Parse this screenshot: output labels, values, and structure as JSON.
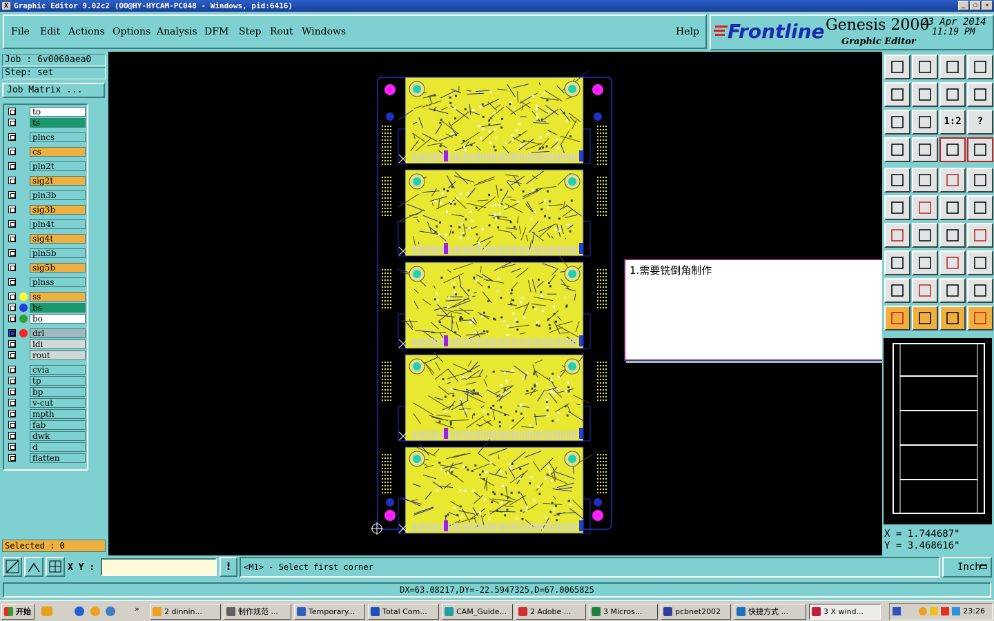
{
  "window": {
    "title": "Graphic Editor 9.02c2  (OO@HY-HYCAM-PC048 - Windows, pid:6416)",
    "app_icon": "X"
  },
  "menu": {
    "items": [
      "File",
      "Edit",
      "Actions",
      "Options",
      "Analysis",
      "DFM",
      "Step",
      "Rout",
      "Windows"
    ],
    "help": "Help"
  },
  "brand": {
    "logo": "Frontline",
    "product": "Genesis 2000",
    "subtitle": "Graphic Editor",
    "date": "23 Apr 2014",
    "time": "11:19 PM"
  },
  "job": {
    "job_label": "Job : 6v0060aea0",
    "step_label": "Step: set",
    "matrix_button": "Job Matrix ..."
  },
  "layers": [
    {
      "name": "to",
      "bg": "#ffffff",
      "dot": ""
    },
    {
      "name": "ts",
      "bg": "#1a9a6a",
      "dot": ""
    },
    {
      "name": "plncs",
      "bg": "#7fd0d0",
      "dot": ""
    },
    {
      "name": "cs",
      "bg": "#f0b040",
      "dot": ""
    },
    {
      "name": "pln2t",
      "bg": "#7fd0d0",
      "dot": ""
    },
    {
      "name": "sig2t",
      "bg": "#f0b040",
      "dot": ""
    },
    {
      "name": "pln3b",
      "bg": "#7fd0d0",
      "dot": ""
    },
    {
      "name": "sig3b",
      "bg": "#f0b040",
      "dot": ""
    },
    {
      "name": "pln4t",
      "bg": "#7fd0d0",
      "dot": ""
    },
    {
      "name": "sig4t",
      "bg": "#f0b040",
      "dot": ""
    },
    {
      "name": "pln5b",
      "bg": "#7fd0d0",
      "dot": ""
    },
    {
      "name": "sig5b",
      "bg": "#f0b040",
      "dot": ""
    },
    {
      "name": "plnss",
      "bg": "#7fd0d0",
      "dot": ""
    },
    {
      "name": "ss",
      "bg": "#f0b040",
      "dot": "#ffff30"
    },
    {
      "name": "bs",
      "bg": "#1a9a6a",
      "dot": "#2040e0"
    },
    {
      "name": "bo",
      "bg": "#ffffff",
      "dot": "#30a030"
    },
    {
      "name": "drl",
      "bg": "#a0b8c0",
      "dot": "#ff2020"
    },
    {
      "name": "ldi",
      "bg": "#d0d8d8",
      "dot": ""
    },
    {
      "name": "rout",
      "bg": "#d0d8d8",
      "dot": ""
    },
    {
      "name": "cvia",
      "bg": "#7fd0d0",
      "dot": ""
    },
    {
      "name": "tp",
      "bg": "#7fd0d0",
      "dot": ""
    },
    {
      "name": "bp",
      "bg": "#7fd0d0",
      "dot": ""
    },
    {
      "name": "v-cut",
      "bg": "#7fd0d0",
      "dot": ""
    },
    {
      "name": "mpth",
      "bg": "#7fd0d0",
      "dot": ""
    },
    {
      "name": "fab",
      "bg": "#7fd0d0",
      "dot": ""
    },
    {
      "name": "dwk",
      "bg": "#7fd0d0",
      "dot": ""
    },
    {
      "name": "d",
      "bg": "#7fd0d0",
      "dot": ""
    },
    {
      "name": "flatten",
      "bg": "#7fd0d0",
      "dot": ""
    }
  ],
  "selected": "Selected : 0",
  "toolbar": {
    "labels": [
      "",
      "",
      "",
      "",
      "",
      "",
      "",
      "",
      "",
      "",
      "1:2",
      "?",
      "",
      "",
      "",
      ""
    ]
  },
  "popup": {
    "text": "1.需要铣倒角制作"
  },
  "coords": {
    "x": "X = 1.744687\"",
    "y": "Y = 3.468616\""
  },
  "command": {
    "xy_label": "X Y :",
    "xy_value": "",
    "message": "<M1> - Select first corner",
    "unit": "Inch",
    "alert": "!"
  },
  "status": {
    "text": "DX=63.08217,DY=-22.5947325,D=67.0065825"
  },
  "taskbar": {
    "start": "开始",
    "tasks": [
      "2 dinnin...",
      "制作规范 ...",
      "Temporary...",
      "Total Com...",
      "CAM_Guide...",
      "2 Adobe ...",
      "3 Micros...",
      "pcbnet2002",
      "快捷方式 ...",
      "3 X wind..."
    ],
    "clock": "23:26"
  },
  "colors": {
    "panel": "#7fd0d0",
    "board": "#e8e830",
    "outline": "#2030c0",
    "pad_magenta": "#ff20ff",
    "pad_cyan": "#20d0b0"
  }
}
